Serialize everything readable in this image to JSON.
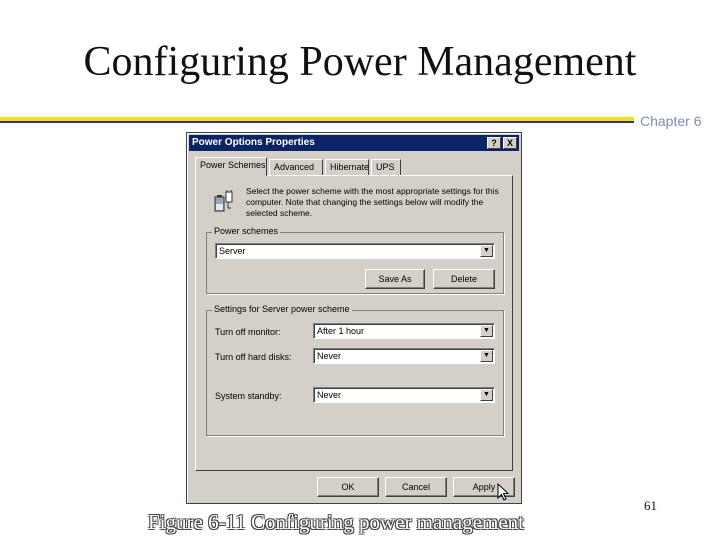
{
  "slide": {
    "title": "Configuring Power Management",
    "chapter": "Chapter 6",
    "page_number": "61",
    "caption": "Figure 6-11  Configuring power management"
  },
  "dialog": {
    "title": "Power Options Properties",
    "help_button": "?",
    "close_button": "X",
    "tabs": [
      "Power Schemes",
      "Advanced",
      "Hibernate",
      "UPS"
    ],
    "active_tab": "Power Schemes",
    "description": "Select the power scheme with the most appropriate settings for this computer. Note that changing the settings below will modify the selected scheme.",
    "power_schemes": {
      "label": "Power schemes",
      "selected": "Server",
      "save_as": "Save As",
      "delete": "Delete"
    },
    "settings": {
      "label": "Settings for Server power scheme",
      "turn_off_monitor_label": "Turn off monitor:",
      "turn_off_monitor_value": "After 1 hour",
      "turn_off_hard_disks_label": "Turn off hard disks:",
      "turn_off_hard_disks_value": "Never",
      "system_standby_label": "System standby:",
      "system_standby_value": "Never"
    },
    "buttons": {
      "ok": "OK",
      "cancel": "Cancel",
      "apply": "Apply"
    }
  },
  "icons": {
    "titlebar": [
      "help-icon",
      "close-icon"
    ],
    "panel": "battery-icon",
    "combo": "chevron-down-icon",
    "pointer": "mouse-cursor-icon"
  },
  "colors": {
    "titlebar": "#0a246a",
    "dialog_face": "#d4d0c8",
    "rule_yellow": "#ffe000",
    "rule_blue": "#1e3a8a",
    "chapter_text": "#7d8db5"
  }
}
